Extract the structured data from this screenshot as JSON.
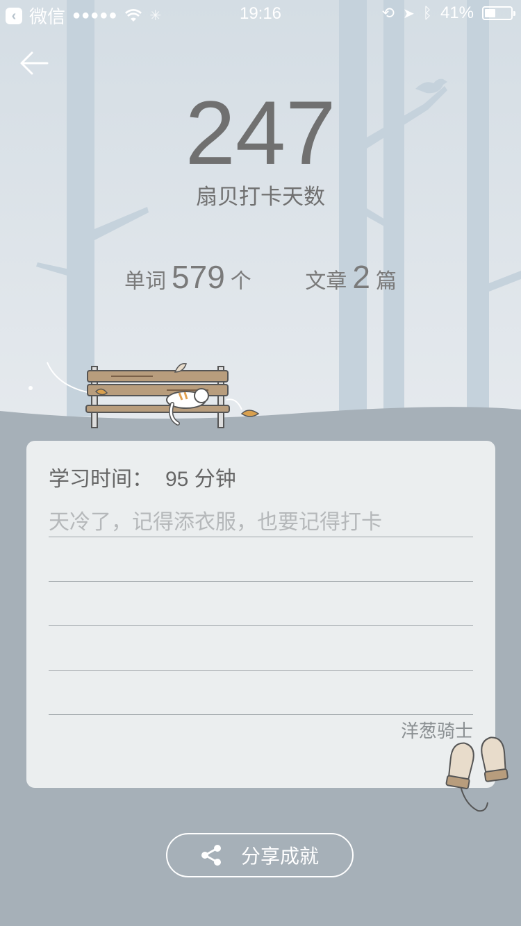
{
  "status_bar": {
    "app_back_label": "微信",
    "time": "19:16",
    "battery": "41%",
    "battery_level": 0.41
  },
  "stats": {
    "checkin_days": "247",
    "checkin_label": "扇贝打卡天数",
    "words_prefix": "单词",
    "words_count": "579",
    "words_unit": "个",
    "articles_prefix": "文章",
    "articles_count": "2",
    "articles_unit": "篇"
  },
  "card": {
    "study_time_label": "学习时间：",
    "study_time_value": "95 分钟",
    "note": "天冷了，记得添衣服，也要记得打卡",
    "author": "洋葱骑士"
  },
  "share_button": {
    "label": "分享成就",
    "icon": "share-icon"
  },
  "colors": {
    "sky": "#d6dfe6",
    "ground": "#a6b0b8",
    "card": "#ebeeef",
    "text": "#707070"
  }
}
